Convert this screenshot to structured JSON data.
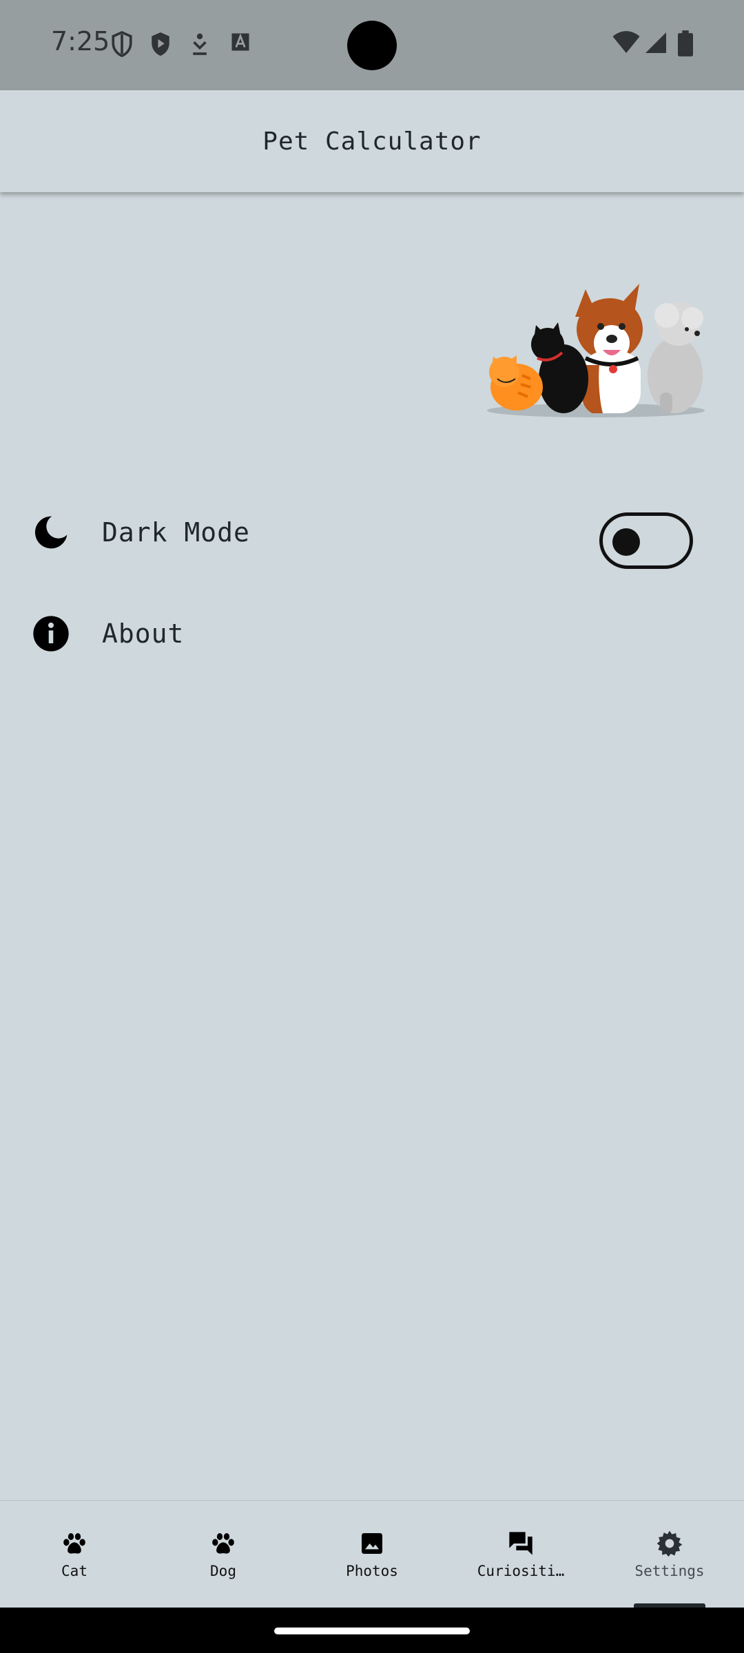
{
  "status_bar": {
    "time": "7:25",
    "left_icons": [
      "shield-outline-icon",
      "play-shield-icon",
      "download-icon",
      "text-a-icon"
    ],
    "right_icons": [
      "wifi-icon",
      "signal-icon",
      "battery-icon"
    ]
  },
  "app_bar": {
    "title": "Pet Calculator"
  },
  "header_image": {
    "description_icon": "pets-illustration"
  },
  "settings": {
    "dark_mode": {
      "icon": "moon-icon",
      "label": "Dark Mode",
      "enabled": false
    },
    "about": {
      "icon": "info-icon",
      "label": "About"
    }
  },
  "bottom_nav": {
    "items": [
      {
        "icon": "paw-icon",
        "label": "Cat"
      },
      {
        "icon": "paw-icon",
        "label": "Dog"
      },
      {
        "icon": "image-icon",
        "label": "Photos"
      },
      {
        "icon": "chat-icon",
        "label": "Curiositi…"
      },
      {
        "icon": "gear-icon",
        "label": "Settings"
      }
    ],
    "active_index": 4
  },
  "colors": {
    "background": "#cfd8dc",
    "status_bar": "#979ea0",
    "text": "#1f272b"
  }
}
